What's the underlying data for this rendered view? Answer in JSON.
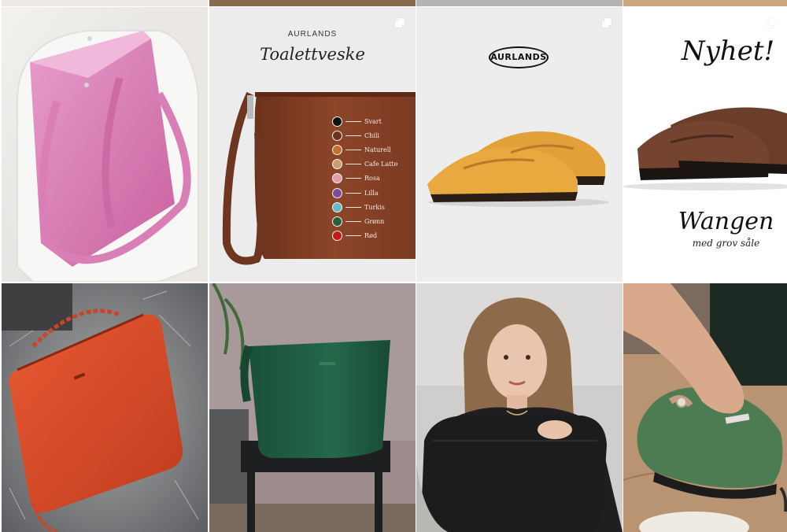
{
  "grid": {
    "posts": [
      {
        "id": "pink-tote",
        "alt": "Pink leather tote bag on a white chair"
      },
      {
        "id": "toiletry-bag",
        "brand": "AURLANDS",
        "title": "Toalettveske",
        "colors": [
          {
            "name": "Svart",
            "hex": "#111111"
          },
          {
            "name": "Chili",
            "hex": "#6a3320"
          },
          {
            "name": "Naturell",
            "hex": "#c1702f"
          },
          {
            "name": "Cafe Latte",
            "hex": "#c9a06d"
          },
          {
            "name": "Rosa",
            "hex": "#e79aae"
          },
          {
            "name": "Lilla",
            "hex": "#7c4d9a"
          },
          {
            "name": "Turkis",
            "hex": "#65bcc0"
          },
          {
            "name": "Grønn",
            "hex": "#2a5f3c"
          },
          {
            "name": "Rød",
            "hex": "#c8161e"
          }
        ]
      },
      {
        "id": "yellow-loafers",
        "logo_text": "AURLANDS"
      },
      {
        "id": "new-loafer",
        "headline": "Nyhet!",
        "product": "Wangen",
        "subtitle": "med grov såle"
      },
      {
        "id": "orange-bag",
        "alt": "Orange leather bag on grey fur"
      },
      {
        "id": "green-bag",
        "alt": "Green leather bag on a small stool"
      },
      {
        "id": "woman-black-bag",
        "alt": "Woman holding a black leather bag"
      },
      {
        "id": "green-loafer",
        "alt": "Hand adjusting a green leather loafer"
      }
    ]
  },
  "colors": {
    "pink": "#de86ba",
    "brown_leather": "#7a3b22",
    "loafer_yellow": "#e3a13a",
    "loafer_brown": "#6a3e2a",
    "orange_bag": "#d44b28",
    "green_bag": "#1f5c41",
    "black_bag": "#1b1c1e",
    "green_loafer": "#4b7a52"
  }
}
